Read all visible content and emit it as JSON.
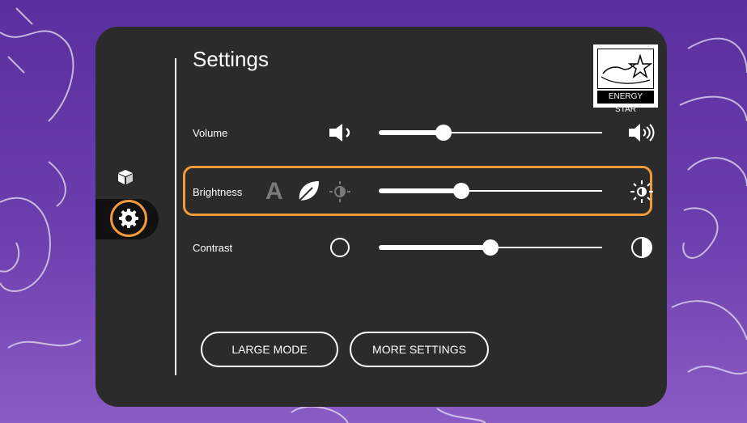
{
  "settings": {
    "title": "Settings",
    "energy_star_label": "ENERGY STAR",
    "energy_script": "energy"
  },
  "rows": {
    "volume": {
      "label": "Volume",
      "value_fraction": 0.29
    },
    "brightness": {
      "label": "Brightness",
      "value_fraction": 0.37,
      "mode_letter": "A"
    },
    "contrast": {
      "label": "Contrast",
      "value_fraction": 0.5
    }
  },
  "buttons": {
    "large_mode": "LARGE MODE",
    "more_settings": "MORE SETTINGS"
  },
  "sidebar": {
    "items": [
      {
        "icon": "cube-icon",
        "selected": false
      },
      {
        "icon": "gear-icon",
        "selected": true
      }
    ]
  },
  "colors": {
    "accent": "#f39a3d",
    "panel": "#2b2b2b",
    "background": "#6b3fae"
  }
}
